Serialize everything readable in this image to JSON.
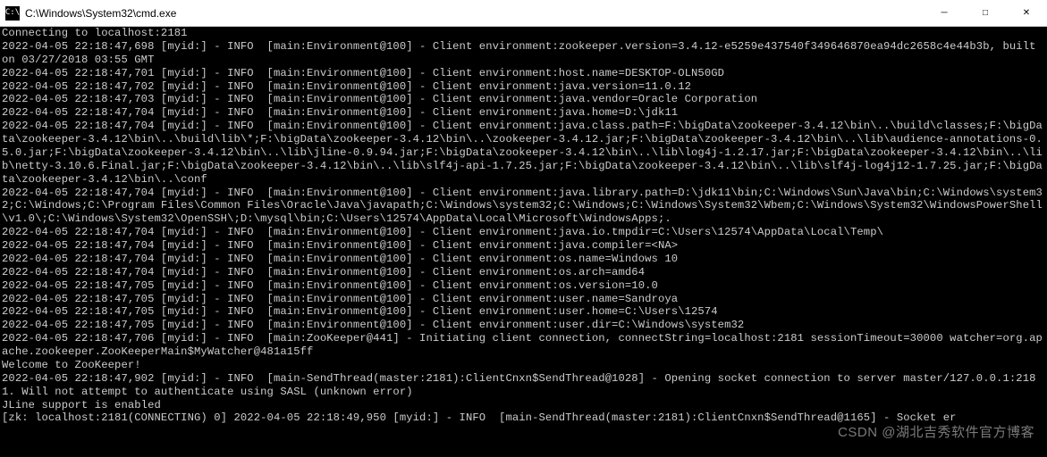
{
  "window": {
    "icon_label": "C:\\",
    "title": "C:\\Windows\\System32\\cmd.exe",
    "min": "─",
    "max": "□",
    "close": "✕"
  },
  "watermark": "CSDN @湖北吉秀软件官方博客",
  "lines": [
    "Connecting to localhost:2181",
    "2022-04-05 22:18:47,698 [myid:] - INFO  [main:Environment@100] - Client environment:zookeeper.version=3.4.12-e5259e437540f349646870ea94dc2658c4e44b3b, built on 03/27/2018 03:55 GMT",
    "2022-04-05 22:18:47,701 [myid:] - INFO  [main:Environment@100] - Client environment:host.name=DESKTOP-OLN50GD",
    "2022-04-05 22:18:47,702 [myid:] - INFO  [main:Environment@100] - Client environment:java.version=11.0.12",
    "2022-04-05 22:18:47,703 [myid:] - INFO  [main:Environment@100] - Client environment:java.vendor=Oracle Corporation",
    "2022-04-05 22:18:47,704 [myid:] - INFO  [main:Environment@100] - Client environment:java.home=D:\\jdk11",
    "2022-04-05 22:18:47,704 [myid:] - INFO  [main:Environment@100] - Client environment:java.class.path=F:\\bigData\\zookeeper-3.4.12\\bin\\..\\build\\classes;F:\\bigData\\zookeeper-3.4.12\\bin\\..\\build\\lib\\*;F:\\bigData\\zookeeper-3.4.12\\bin\\..\\zookeeper-3.4.12.jar;F:\\bigData\\zookeeper-3.4.12\\bin\\..\\lib\\audience-annotations-0.5.0.jar;F:\\bigData\\zookeeper-3.4.12\\bin\\..\\lib\\jline-0.9.94.jar;F:\\bigData\\zookeeper-3.4.12\\bin\\..\\lib\\log4j-1.2.17.jar;F:\\bigData\\zookeeper-3.4.12\\bin\\..\\lib\\netty-3.10.6.Final.jar;F:\\bigData\\zookeeper-3.4.12\\bin\\..\\lib\\slf4j-api-1.7.25.jar;F:\\bigData\\zookeeper-3.4.12\\bin\\..\\lib\\slf4j-log4j12-1.7.25.jar;F:\\bigData\\zookeeper-3.4.12\\bin\\..\\conf",
    "2022-04-05 22:18:47,704 [myid:] - INFO  [main:Environment@100] - Client environment:java.library.path=D:\\jdk11\\bin;C:\\Windows\\Sun\\Java\\bin;C:\\Windows\\system32;C:\\Windows;C:\\Program Files\\Common Files\\Oracle\\Java\\javapath;C:\\Windows\\system32;C:\\Windows;C:\\Windows\\System32\\Wbem;C:\\Windows\\System32\\WindowsPowerShell\\v1.0\\;C:\\Windows\\System32\\OpenSSH\\;D:\\mysql\\bin;C:\\Users\\12574\\AppData\\Local\\Microsoft\\WindowsApps;.",
    "2022-04-05 22:18:47,704 [myid:] - INFO  [main:Environment@100] - Client environment:java.io.tmpdir=C:\\Users\\12574\\AppData\\Local\\Temp\\",
    "2022-04-05 22:18:47,704 [myid:] - INFO  [main:Environment@100] - Client environment:java.compiler=<NA>",
    "2022-04-05 22:18:47,704 [myid:] - INFO  [main:Environment@100] - Client environment:os.name=Windows 10",
    "2022-04-05 22:18:47,704 [myid:] - INFO  [main:Environment@100] - Client environment:os.arch=amd64",
    "2022-04-05 22:18:47,705 [myid:] - INFO  [main:Environment@100] - Client environment:os.version=10.0",
    "2022-04-05 22:18:47,705 [myid:] - INFO  [main:Environment@100] - Client environment:user.name=Sandroya",
    "2022-04-05 22:18:47,705 [myid:] - INFO  [main:Environment@100] - Client environment:user.home=C:\\Users\\12574",
    "2022-04-05 22:18:47,705 [myid:] - INFO  [main:Environment@100] - Client environment:user.dir=C:\\Windows\\system32",
    "2022-04-05 22:18:47,706 [myid:] - INFO  [main:ZooKeeper@441] - Initiating client connection, connectString=localhost:2181 sessionTimeout=30000 watcher=org.apache.zookeeper.ZooKeeperMain$MyWatcher@481a15ff",
    "Welcome to ZooKeeper!",
    "2022-04-05 22:18:47,902 [myid:] - INFO  [main-SendThread(master:2181):ClientCnxn$SendThread@1028] - Opening socket connection to server master/127.0.0.1:2181. Will not attempt to authenticate using SASL (unknown error)",
    "JLine support is enabled",
    "[zk: localhost:2181(CONNECTING) 0] 2022-04-05 22:18:49,950 [myid:] - INFO  [main-SendThread(master:2181):ClientCnxn$SendThread@1165] - Socket er"
  ]
}
